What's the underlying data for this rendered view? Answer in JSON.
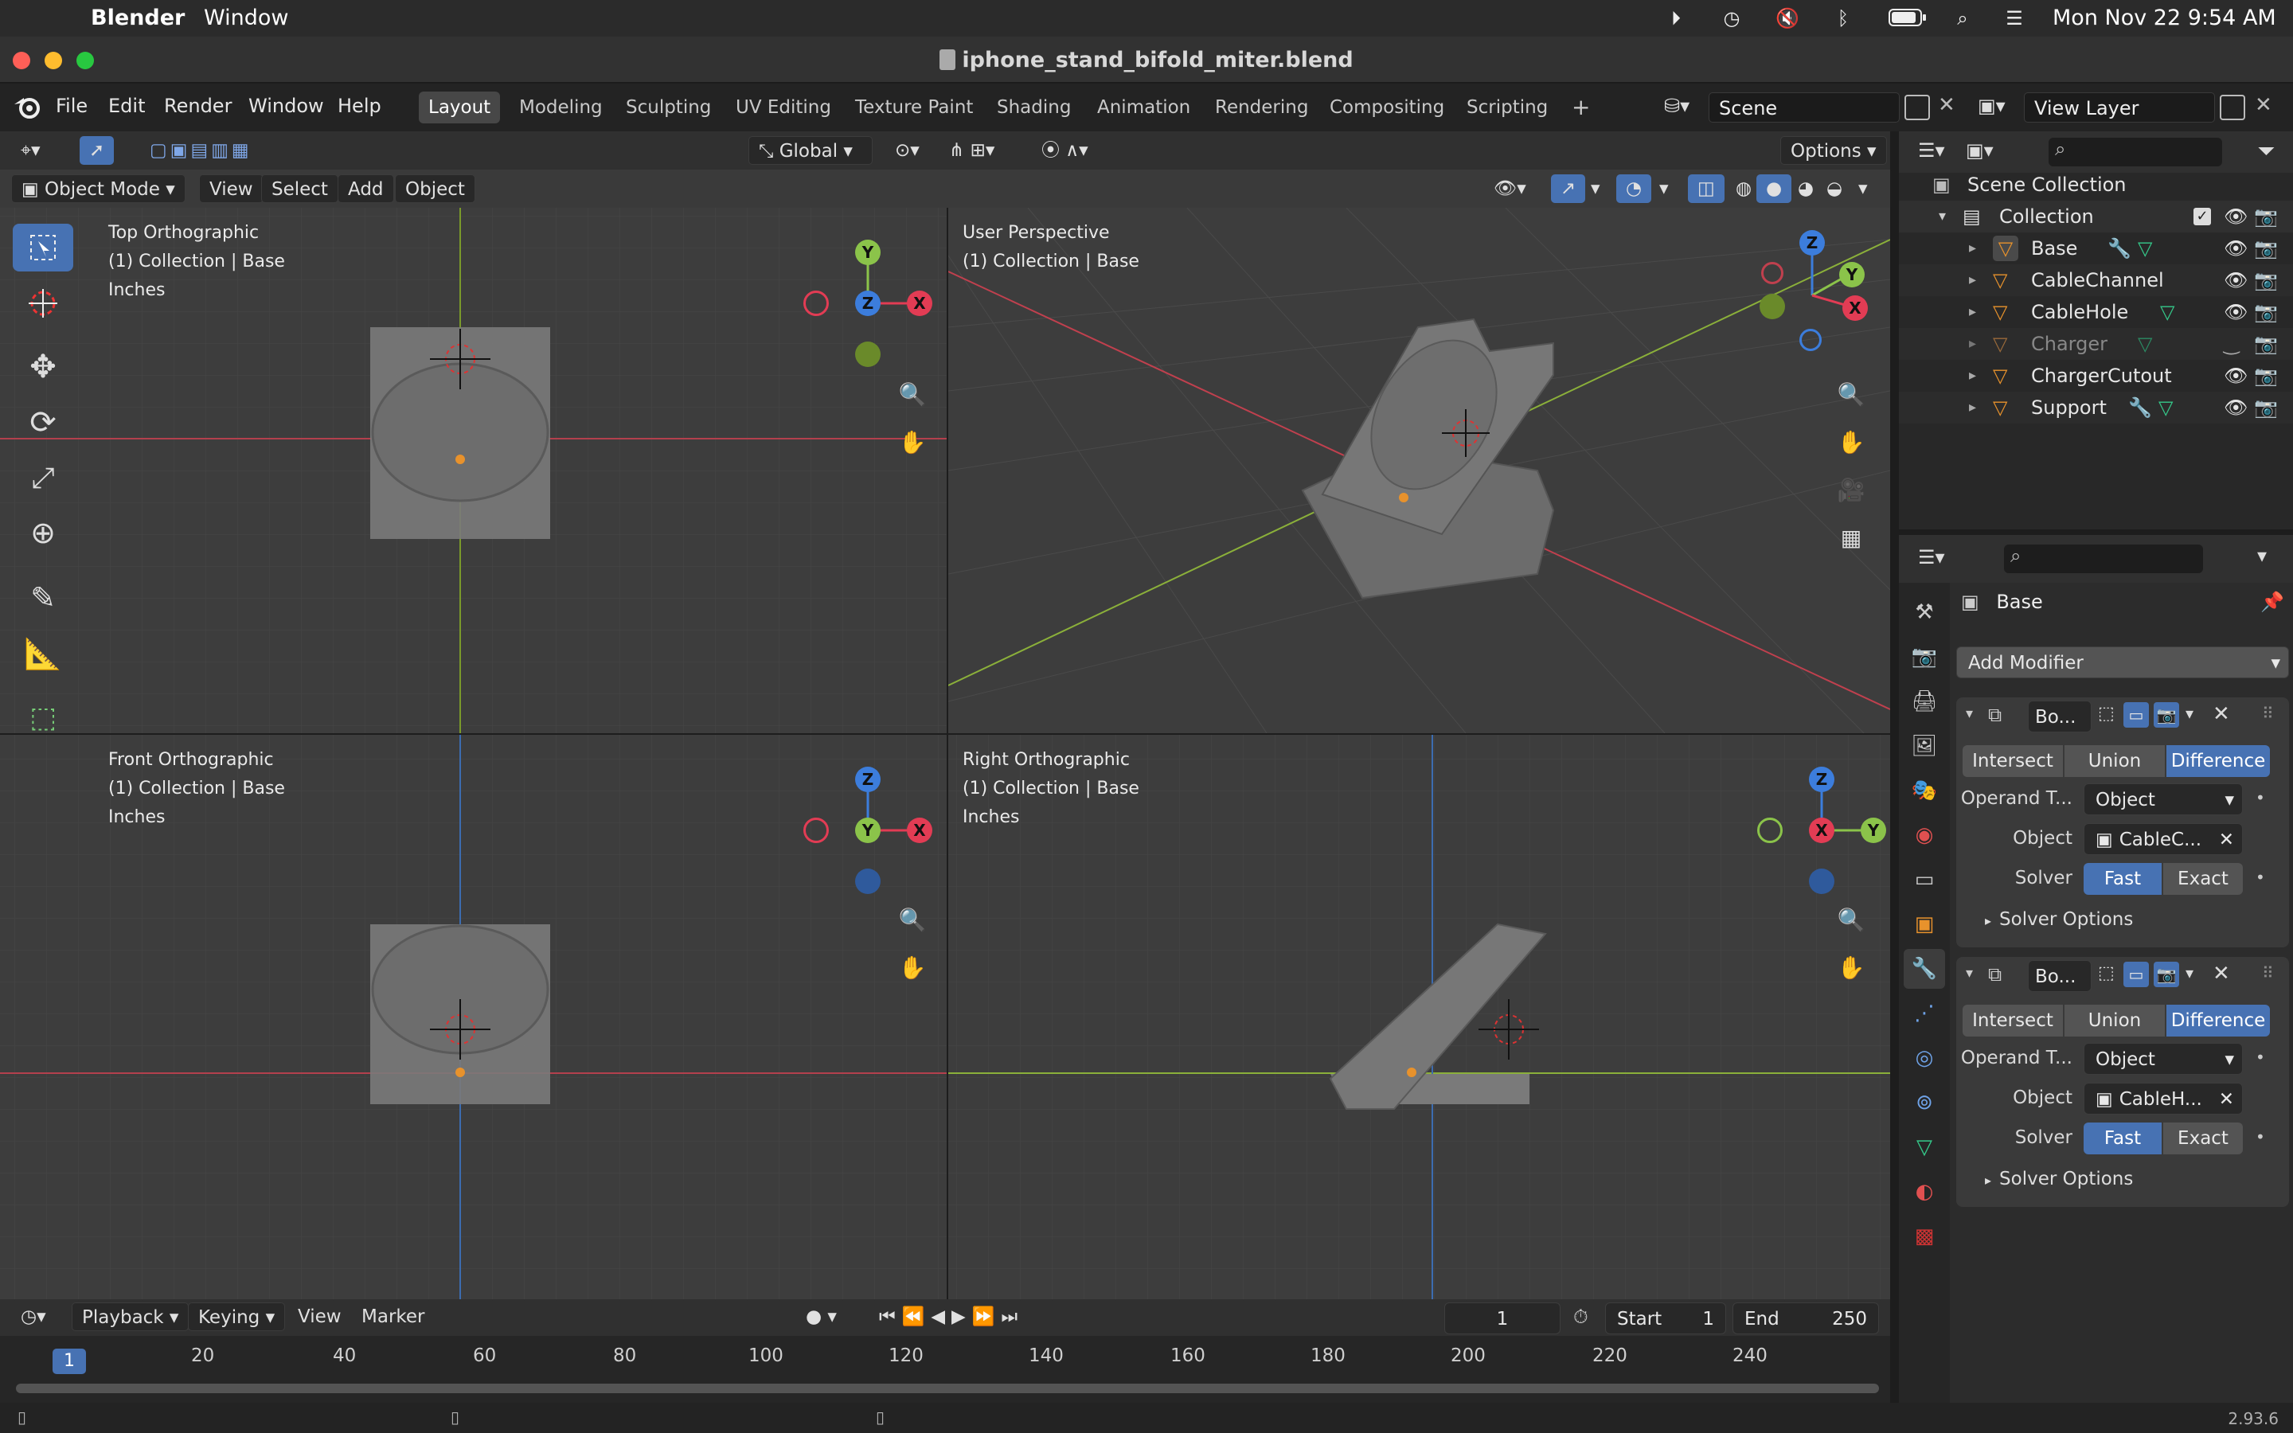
{
  "menubar": {
    "app": "Blender",
    "window": "Window",
    "datetime": "Mon Nov 22  9:54 AM"
  },
  "titlebar": {
    "title": "iphone_stand_bifold_miter.blend"
  },
  "topbar": {
    "menus": [
      "File",
      "Edit",
      "Render",
      "Window",
      "Help"
    ],
    "workspaces": [
      "Layout",
      "Modeling",
      "Sculpting",
      "UV Editing",
      "Texture Paint",
      "Shading",
      "Animation",
      "Rendering",
      "Compositing",
      "Scripting"
    ],
    "active_workspace": "Layout",
    "scene": "Scene",
    "view_layer": "View Layer"
  },
  "viewport_header": {
    "transform_orientation": "Global",
    "options": "Options",
    "mode": "Object Mode",
    "menus": [
      "View",
      "Select",
      "Add",
      "Object"
    ]
  },
  "viewports": {
    "top": {
      "title": "Top Orthographic",
      "collection": "(1) Collection | Base",
      "units": "Inches"
    },
    "persp": {
      "title": "User Perspective",
      "collection": "(1) Collection | Base"
    },
    "front": {
      "title": "Front Orthographic",
      "collection": "(1) Collection | Base",
      "units": "Inches"
    },
    "right": {
      "title": "Right Orthographic",
      "collection": "(1) Collection | Base",
      "units": "Inches"
    }
  },
  "axis_labels": {
    "x": "X",
    "y": "Y",
    "z": "Z"
  },
  "outliner": {
    "scene_collection": "Scene Collection",
    "collection": "Collection",
    "objects": [
      "Base",
      "CableChannel",
      "CableHole",
      "Charger",
      "ChargerCutout",
      "Support"
    ]
  },
  "properties": {
    "object_name": "Base",
    "add_modifier": "Add Modifier",
    "modifiers": [
      {
        "name": "Bo...",
        "ops": [
          "Intersect",
          "Union",
          "Difference"
        ],
        "operand_label": "Operand T...",
        "operand_value": "Object",
        "object_label": "Object",
        "object_value": "CableC...",
        "solver_label": "Solver",
        "solver_options": [
          "Fast",
          "Exact"
        ],
        "solver_section": "Solver Options"
      },
      {
        "name": "Bo...",
        "ops": [
          "Intersect",
          "Union",
          "Difference"
        ],
        "operand_label": "Operand T...",
        "operand_value": "Object",
        "object_label": "Object",
        "object_value": "CableH...",
        "solver_label": "Solver",
        "solver_options": [
          "Fast",
          "Exact"
        ],
        "solver_section": "Solver Options"
      }
    ]
  },
  "timeline": {
    "menus": [
      "Playback",
      "Keying",
      "View",
      "Marker"
    ],
    "current_frame": "1",
    "start_label": "Start",
    "start": "1",
    "end_label": "End",
    "end": "250",
    "ticks": [
      "1",
      "20",
      "40",
      "60",
      "80",
      "100",
      "120",
      "140",
      "160",
      "180",
      "200",
      "220",
      "240"
    ]
  },
  "status": {
    "version": "2.93.6"
  },
  "colors": {
    "accent": "#4772b3",
    "x_axis": "#e23c54",
    "y_axis": "#8bc34a",
    "z_axis": "#3c7ddc",
    "orange": "#e8922c"
  }
}
